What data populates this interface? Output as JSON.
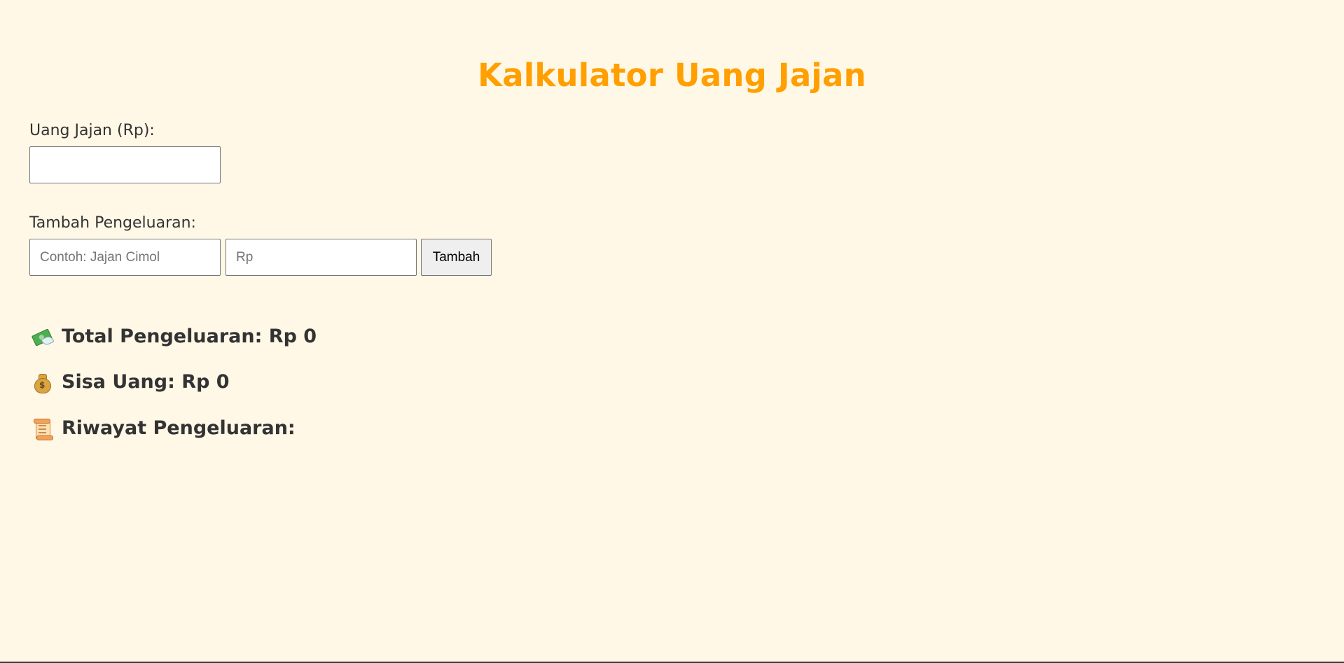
{
  "page": {
    "title": "Kalkulator Uang Jajan"
  },
  "budget": {
    "label": "Uang Jajan (Rp):",
    "value": "",
    "placeholder": ""
  },
  "expense_form": {
    "label": "Tambah Pengeluaran:",
    "name_value": "",
    "name_placeholder": "Contoh: Jajan Cimol",
    "amount_value": "",
    "amount_placeholder": "Rp",
    "add_button_label": "Tambah"
  },
  "summary": {
    "total_label": "Total Pengeluaran: Rp 0",
    "total_icon": "money-with-wings-icon",
    "remaining_label": "Sisa Uang: Rp 0",
    "remaining_icon": "money-bag-icon",
    "history_label": "Riwayat Pengeluaran:",
    "history_icon": "scroll-icon"
  },
  "colors": {
    "background": "#fff8e7",
    "title": "#ff9f00",
    "text": "#333333"
  }
}
